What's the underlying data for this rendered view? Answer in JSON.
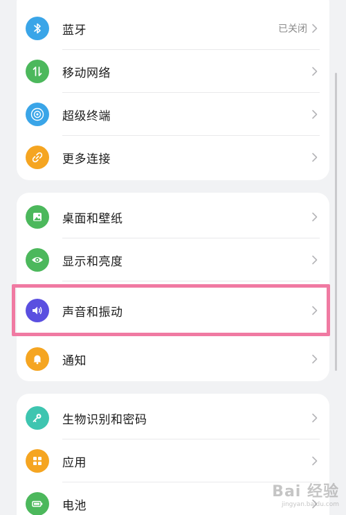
{
  "groups": [
    {
      "items": [
        {
          "label": "蓝牙",
          "value": "已关闭",
          "icon": "bluetooth-icon",
          "color": "#3aa5e8"
        },
        {
          "label": "移动网络",
          "value": "",
          "icon": "mobile-data-icon",
          "color": "#4cb85c"
        },
        {
          "label": "超级终端",
          "value": "",
          "icon": "super-device-icon",
          "color": "#3aa5e8"
        },
        {
          "label": "更多连接",
          "value": "",
          "icon": "link-icon",
          "color": "#f5a521"
        }
      ]
    },
    {
      "items": [
        {
          "label": "桌面和壁纸",
          "value": "",
          "icon": "wallpaper-icon",
          "color": "#4cb85c"
        },
        {
          "label": "显示和亮度",
          "value": "",
          "icon": "eye-icon",
          "color": "#4cb85c"
        },
        {
          "label": "声音和振动",
          "value": "",
          "icon": "speaker-icon",
          "color": "#5a4fe0"
        },
        {
          "label": "通知",
          "value": "",
          "icon": "bell-icon",
          "color": "#f5a521"
        }
      ]
    },
    {
      "items": [
        {
          "label": "生物识别和密码",
          "value": "",
          "icon": "key-icon",
          "color": "#3ec5b0"
        },
        {
          "label": "应用",
          "value": "",
          "icon": "apps-icon",
          "color": "#f5a521"
        },
        {
          "label": "电池",
          "value": "",
          "icon": "battery-icon",
          "color": "#4cb85c"
        }
      ]
    }
  ],
  "highlight_color": "#f07aa2",
  "watermark": {
    "main": "Bai 经验",
    "sub": "jingyan.baidu.com"
  }
}
